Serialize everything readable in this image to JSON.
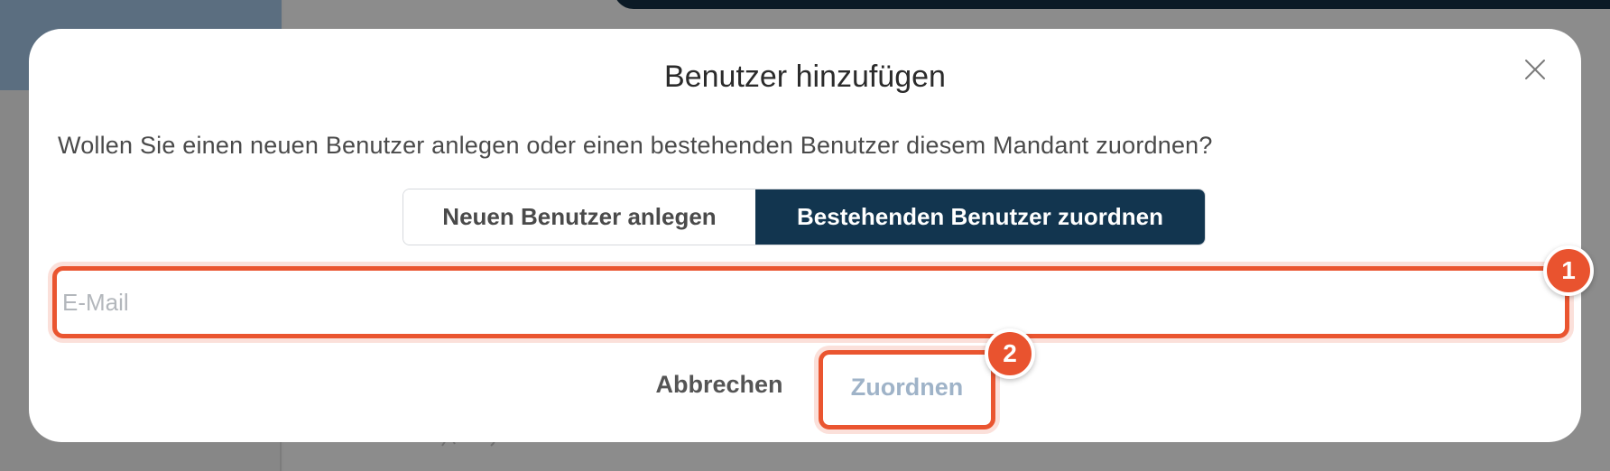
{
  "dialog": {
    "title": "Benutzer hinzufügen",
    "question": "Wollen Sie einen neuen Benutzer anlegen oder einen bestehenden Benutzer diesem Mandant zuordnen?",
    "close_icon": "close-icon"
  },
  "mode_toggle": {
    "options": [
      {
        "label": "Neuen Benutzer anlegen",
        "selected": false
      },
      {
        "label": "Bestehenden Benutzer zuordnen",
        "selected": true
      }
    ]
  },
  "email_field": {
    "placeholder": "E-Mail",
    "value": ""
  },
  "actions": {
    "cancel_label": "Abbrechen",
    "assign_label": "Zuordnen"
  },
  "annotations": [
    {
      "number": "1"
    },
    {
      "number": "2"
    }
  ],
  "colors": {
    "primary": "#12354f",
    "highlight": "#ea5530",
    "disabled_text": "#9fb3c8"
  }
}
